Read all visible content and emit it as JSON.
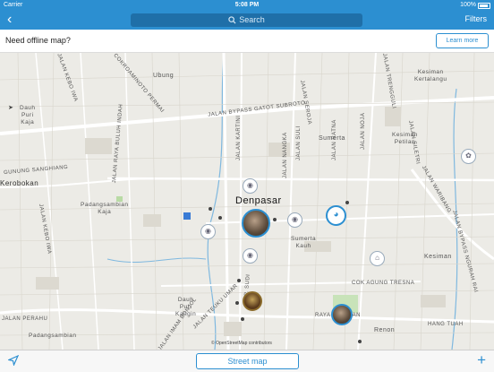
{
  "status": {
    "carrier": "Carrier",
    "time": "5:08 PM",
    "battery": "100%"
  },
  "nav": {
    "search_placeholder": "Search",
    "filters": "Filters"
  },
  "offline": {
    "message": "Need offline map?",
    "learn_more": "Learn more"
  },
  "map": {
    "city": "Denpasar",
    "attribution": "© OpenStreetMap contributors",
    "labels": {
      "ubung": "Ubung",
      "dauh_puri_kaja": "Dauh\nPuri\nKaja",
      "gunung": "GUNUNG SANGHIANG",
      "kerobokan": "Kerobokan",
      "padang_kaja": "Padangsambian\nKaja",
      "jalan_bypass": "JALAN BYPASS GATOT SUBROTO",
      "kesiman_kertalangu": "Kesiman\nKertalangu",
      "kesiman_petilan": "Kesiman\nPetilan",
      "sumerta": "Sumerta",
      "sumerta_kauh": "Sumerta\nKauh",
      "cok_agung": "COK AGUNG TRESNA",
      "kesiman": "Kesiman",
      "hang_tuah": "HANG TUAH",
      "renon": "Renon",
      "dauh_puri_kangin": "Dauh\nPuri\nKangin",
      "padangsambian": "Padangsambian",
      "jalan_kebo_iwa": "JALAN KEBO IWA",
      "jalan_kebo_iwa_2": "JALAN KEBO IWA",
      "jalan_kartini": "JALAN KARTINI",
      "jalan_nangka": "JALAN NANGKA",
      "jalan_suli": "JALAN SULI",
      "jalan_ratna": "JALAN RATNA",
      "jalan_noja": "JALAN NOJA",
      "jalan_seroja": "JALAN SEROJA",
      "jalan_trengguli": "JALAN TRENGGULI",
      "jalan_siletri": "JALAN SILETRI",
      "jalan_waribang": "JALAN WARIBANG",
      "jalan_bypass_ngurah": "JALAN BYPASS NGURAH RAI",
      "jalan_raya_buluh": "JALAN RAYA BULUH INDAH",
      "jalan_teuku": "JALAN TEUKU UMAR",
      "jalan_perahu": "JALAN PERAHU",
      "jalan_imam": "JALAN IMAM BONJOL",
      "cokro": "COKROAMINOTO PERMAI",
      "sudirman": "JL P. SUDI",
      "raya_puputan": "RAYA PUPUTAN"
    }
  },
  "bottom": {
    "street_map": "Street map"
  }
}
